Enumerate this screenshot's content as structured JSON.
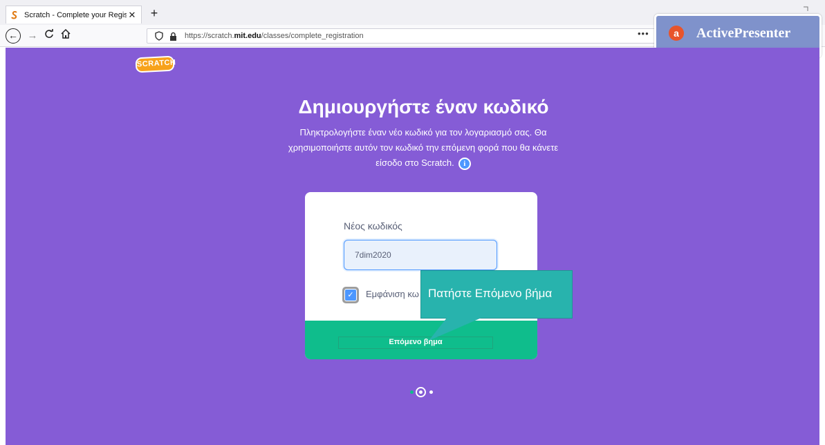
{
  "browser": {
    "tab_title": "Scratch - Complete your Regist",
    "tab_close": "✕",
    "new_tab": "+",
    "url_prefix": "https://scratch.",
    "url_domain": "mit.edu",
    "url_suffix": "/classes/complete_registration",
    "more_menu": "•••"
  },
  "overlay": {
    "text": "ActivePresenter",
    "logo": "a"
  },
  "page": {
    "logo_text": "SCRATCH",
    "heading": "Δημιουργήστε έναν κωδικό",
    "description": "Πληκτρολογήστε έναν νέο κωδικό για τον λογαριασμό σας. Θα χρησιμοποιήστε αυτόν τον κωδικό την επόμενη φορά που θα κάνετε είσοδο στο Scratch.",
    "info_icon": "i"
  },
  "form": {
    "password_label": "Νέος κωδικός",
    "password_value": "7dim2020",
    "show_password_label": "Εμφάνιση κω",
    "show_password_checked": true,
    "next_button": "Επόμενο βήμα"
  },
  "callout": {
    "text": "Πατήστε Επόμενο βήμα"
  },
  "pagination": {
    "steps": 3,
    "current": 2
  },
  "colors": {
    "page_bg": "#855cd6",
    "next_bar": "#0fbd8c",
    "callout": "#28b3ad",
    "accent": "#4c97ff"
  }
}
